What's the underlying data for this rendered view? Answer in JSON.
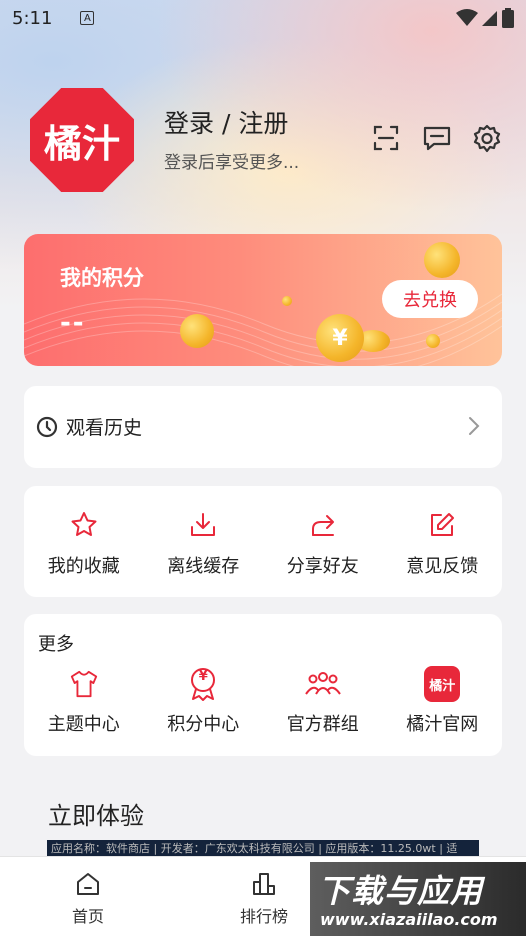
{
  "status_bar": {
    "time": "5:11",
    "notification_glyph": "A"
  },
  "profile": {
    "logo_text": "橘汁",
    "login_title": "登录 / 注册",
    "login_subtitle": "登录后享受更多..."
  },
  "points_card": {
    "title": "我的积分",
    "value": "--",
    "button_label": "去兑换",
    "coin_symbol": "¥"
  },
  "history": {
    "label": "观看历史"
  },
  "actions": [
    {
      "label": "我的收藏",
      "icon": "star-icon"
    },
    {
      "label": "离线缓存",
      "icon": "download-icon"
    },
    {
      "label": "分享好友",
      "icon": "share-icon"
    },
    {
      "label": "意见反馈",
      "icon": "edit-icon"
    }
  ],
  "more": {
    "title": "更多",
    "items": [
      {
        "label": "主题中心",
        "icon": "tshirt-icon"
      },
      {
        "label": "积分中心",
        "icon": "medal-icon",
        "glyph": "¥"
      },
      {
        "label": "官方群组",
        "icon": "group-icon"
      },
      {
        "label": "橘汁官网",
        "icon": "app-logo-icon",
        "glyph": "橘汁"
      }
    ]
  },
  "try_section": {
    "title": "立即体验",
    "info_text": "应用名称：软件商店 | 开发者：广东欢太科技有限公司 | 应用版本：11.25.0wt | 适"
  },
  "bottom_nav": [
    {
      "label": "首页",
      "icon": "home-icon"
    },
    {
      "label": "排行榜",
      "icon": "ranking-icon"
    }
  ],
  "watermark": {
    "title": "下载与应用",
    "url": "www.xiazaiilao.com"
  },
  "colors": {
    "accent": "#e8283a",
    "card_gradient_start": "#fd6e6e",
    "card_gradient_end": "#ffc39a"
  }
}
